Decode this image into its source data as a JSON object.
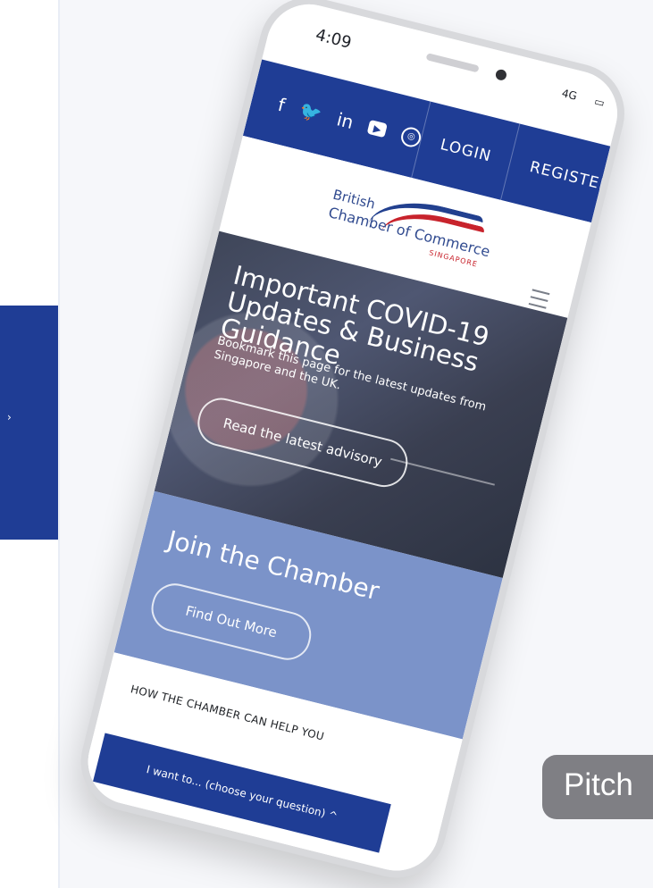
{
  "phone": {
    "status": {
      "time": "4:09",
      "signal": "4G",
      "battery_icon": "battery-icon"
    },
    "topbar": {
      "social_icons": [
        {
          "name": "facebook-icon",
          "glyph": "f"
        },
        {
          "name": "twitter-icon",
          "glyph": "🐦"
        },
        {
          "name": "linkedin-icon",
          "glyph": "in"
        },
        {
          "name": "youtube-icon",
          "glyph": "▶"
        },
        {
          "name": "rss-icon",
          "glyph": "◎"
        }
      ],
      "login": "LOGIN",
      "register": "REGISTER"
    },
    "logo": {
      "line1": "British",
      "line2": "Chamber of Commerce",
      "line3": "SINGAPORE"
    },
    "hero": {
      "title": "Important COVID-19 Updates & Business Guidance",
      "subtitle": "Bookmark this page for the latest updates from Singapore and the UK.",
      "button": "Read the latest advisory"
    },
    "join": {
      "title": "Join the Chamber",
      "button": "Find Out More"
    },
    "help": {
      "heading": "HOW THE CHAMBER CAN HELP YOU",
      "select_value": "I want to... (choose your question) ^"
    }
  },
  "right_badge": {
    "label": "Pitch"
  },
  "left_panel": {
    "arrow": "›"
  },
  "colors": {
    "brand_blue": "#1f3d95",
    "hero_dark": "#444b60",
    "join_blue": "#7b93c9",
    "accent_red": "#c8232c"
  }
}
